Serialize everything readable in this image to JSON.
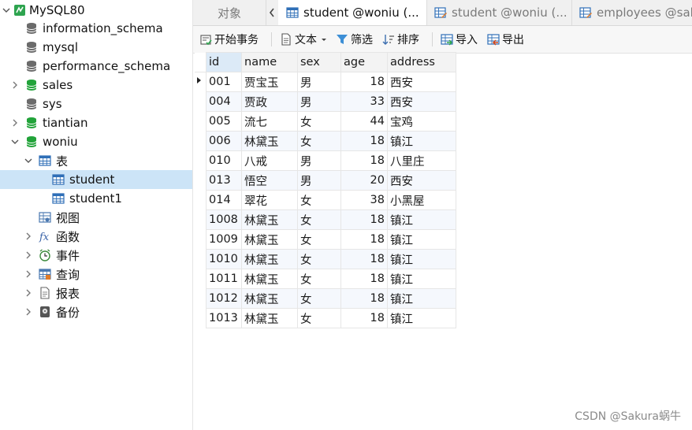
{
  "sidebar": {
    "connection": "MySQL80",
    "databases": [
      "information_schema",
      "mysql",
      "performance_schema",
      "sales",
      "sys",
      "tiantian",
      "woniu"
    ],
    "woniu_children": {
      "tables_label": "表",
      "tables": [
        "student",
        "student1"
      ],
      "views_label": "视图",
      "functions_label": "函数",
      "events_label": "事件",
      "queries_label": "查询",
      "reports_label": "报表",
      "backups_label": "备份"
    }
  },
  "tabs": {
    "objects": "对象",
    "tab1": "student @woniu (...",
    "tab2": "student @woniu (...",
    "tab3": "employees @sale"
  },
  "toolbar": {
    "begin_transaction": "开始事务",
    "text": "文本",
    "filter": "筛选",
    "sort": "排序",
    "import": "导入",
    "export": "导出"
  },
  "table": {
    "columns": [
      "id",
      "name",
      "sex",
      "age",
      "address"
    ],
    "rows": [
      [
        "001",
        "贾宝玉",
        "男",
        "18",
        "西安"
      ],
      [
        "004",
        "贾政",
        "男",
        "33",
        "西安"
      ],
      [
        "005",
        "流七",
        "女",
        "44",
        "宝鸡"
      ],
      [
        "006",
        "林黛玉",
        "女",
        "18",
        "镇江"
      ],
      [
        "010",
        "八戒",
        "男",
        "18",
        "八里庄"
      ],
      [
        "013",
        "悟空",
        "男",
        "20",
        "西安"
      ],
      [
        "014",
        "翠花",
        "女",
        "38",
        "小黑屋"
      ],
      [
        "1008",
        "林黛玉",
        "女",
        "18",
        "镇江"
      ],
      [
        "1009",
        "林黛玉",
        "女",
        "18",
        "镇江"
      ],
      [
        "1010",
        "林黛玉",
        "女",
        "18",
        "镇江"
      ],
      [
        "1011",
        "林黛玉",
        "女",
        "18",
        "镇江"
      ],
      [
        "1012",
        "林黛玉",
        "女",
        "18",
        "镇江"
      ],
      [
        "1013",
        "林黛玉",
        "女",
        "18",
        "镇江"
      ]
    ]
  },
  "watermark": "CSDN @Sakura蜗牛",
  "colors": {
    "selection": "#cce4f7",
    "db_green": "#22a33a",
    "db_gray": "#6b6b6b",
    "table_icon_blue": "#2f6fb7"
  }
}
